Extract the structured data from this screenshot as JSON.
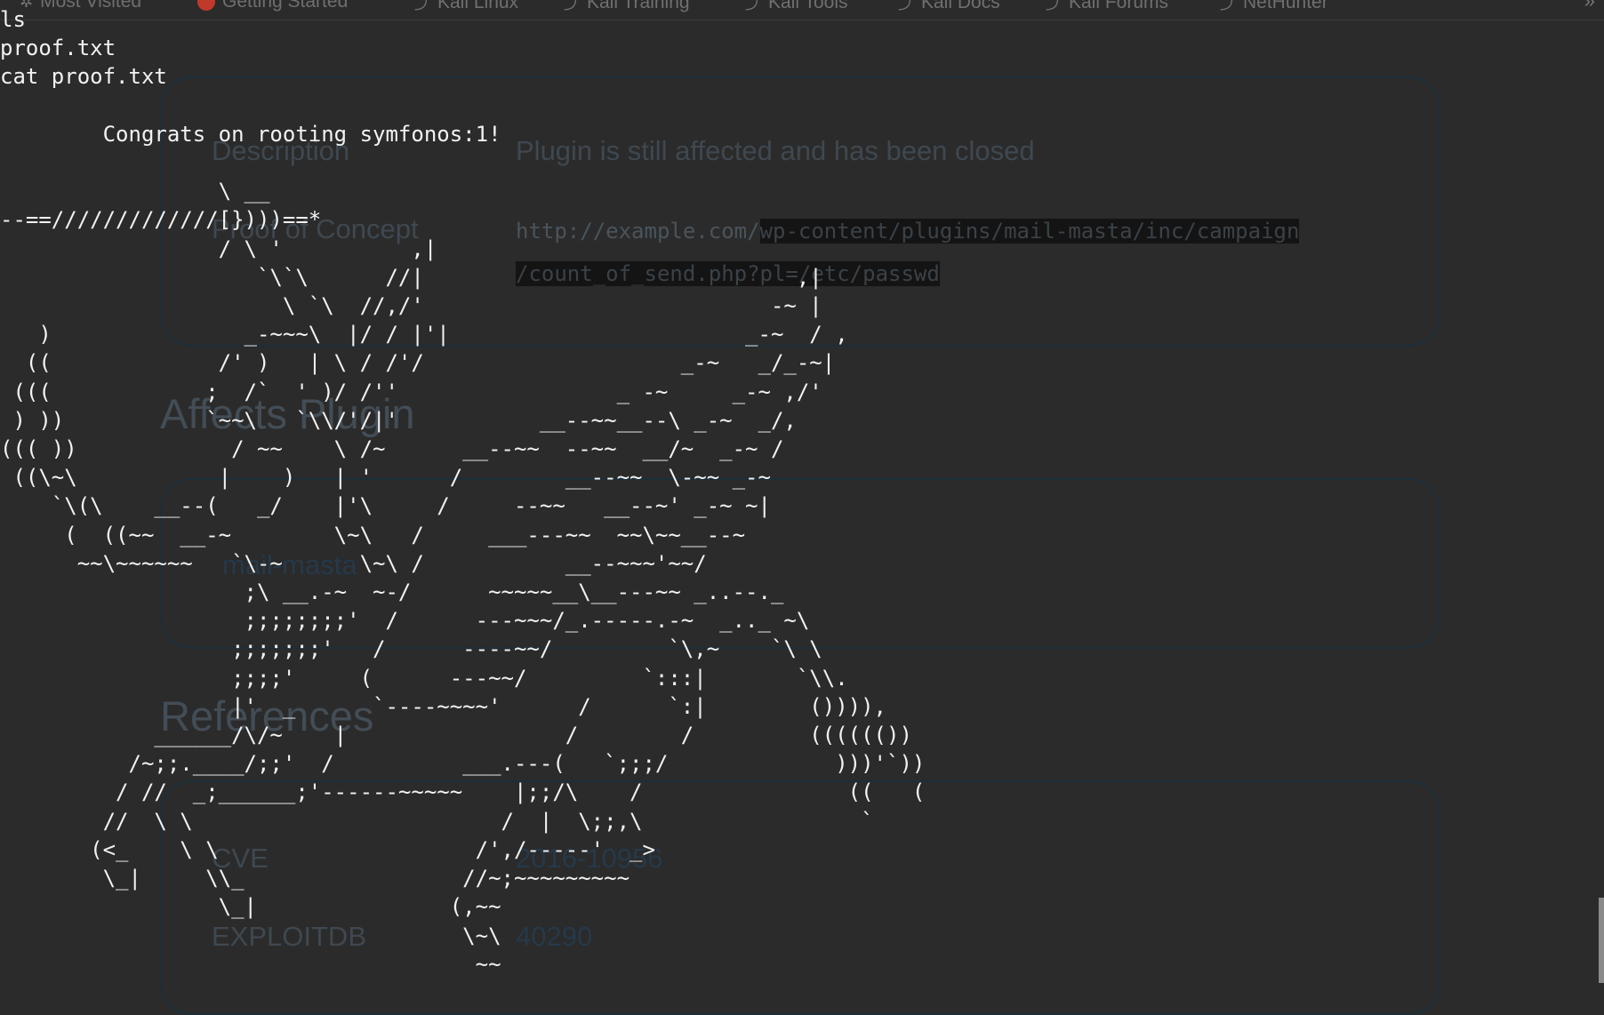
{
  "bookmarks": [
    {
      "label": "Most Visited",
      "icon": "gear-icon"
    },
    {
      "label": "Getting Started",
      "icon": "firefox-icon"
    },
    {
      "label": "Kali Linux",
      "icon": "kali-dragon-icon"
    },
    {
      "label": "Kali Training",
      "icon": "kali-dragon-icon"
    },
    {
      "label": "Kali Tools",
      "icon": "kali-dragon-icon"
    },
    {
      "label": "Kali Docs",
      "icon": "kali-dragon-icon"
    },
    {
      "label": "Kali Forums",
      "icon": "kali-dragon-icon"
    },
    {
      "label": "NetHunter",
      "icon": "kali-dragon-icon"
    }
  ],
  "webpage": {
    "details": {
      "description_label": "Description",
      "description_value": "Plugin is still affected and has been closed",
      "poc_label": "Proof of Concept",
      "poc_prefix": "http://example.com/",
      "poc_selected_1": "wp-content/plugins/mail-masta/inc/campaign",
      "poc_selected_2": "/count_of_send.php?pl=/etc/passwd"
    },
    "affects_heading": "Affects Plugin",
    "plugin_name": "mail-masta",
    "references_heading": "References",
    "references": {
      "cve_label": "CVE",
      "cve_value": "2016-10956",
      "exploitdb_label": "EXPLOITDB",
      "exploitdb_value": "40290"
    }
  },
  "terminal": {
    "lines": [
      "ls",
      "proof.txt",
      "cat proof.txt",
      "",
      "        Congrats on rooting symfonos:1!",
      "",
      "                 \\ __",
      "--==/////////////[})))==*",
      "                 / \\ '          ,|",
      "                    `\\`\\      //|                             ,|",
      "                      \\ `\\  //,/'                           -~ |",
      "   )               _-~~~\\  |/ / |'|                       _-~  / ,",
      "  ((             /' )   | \\ / /'/                    _-~   _/_-~|",
      " (((            ;  /`  ' )/ /''                 _ -~     _-~ ,/'",
      " ) ))           `~~\\   `\\\\/'/|'           __--~~__--\\ _-~  _/,",
      "((( ))            / ~~    \\ /~      __--~~  --~~  __/~  _-~ /",
      " ((\\~\\           |    )   | '      /        __--~~  \\-~~ _-~",
      "    `\\(\\    __--(   _/    |'\\     /     --~~   __--~' _-~ ~|",
      "     (  ((~~  __-~        \\~\\   /     ___---~~  ~~\\~~__--~",
      "      ~~\\~~~~~~   `\\-~      \\~\\ /           __--~~~'~~/",
      "                   ;\\ __.-~  ~-/      ~~~~~__\\__---~~ _..--._",
      "                   ;;;;;;;;'  /      ---~~~/_.-----.-~  _.._ ~\\",
      "                  ;;;;;;;'   /      ----~~/         `\\,~    `\\ \\",
      "                  ;;;;'     (      ---~~/         `:::|       `\\\\.",
      "                  |'  _      `----~~~~'      /      `:|        ()))),",
      "            ______/\\/~    |                 /        /         (((((())",
      "          /~;;.____/;;'  /          ___.---(   `;;;/             )))'`))",
      "         / //  _;______;'------~~~~~    |;;/\\    /                ((   (",
      "        //  \\ \\                        /  |  \\;;,\\                 `",
      "       (<_    \\ \\                    /',/-----'  _>",
      "        \\_|     \\\\_                 //~;~~~~~~~~~",
      "                 \\_|               (,~~",
      "                                    \\~\\",
      "                                     ~~"
    ]
  }
}
